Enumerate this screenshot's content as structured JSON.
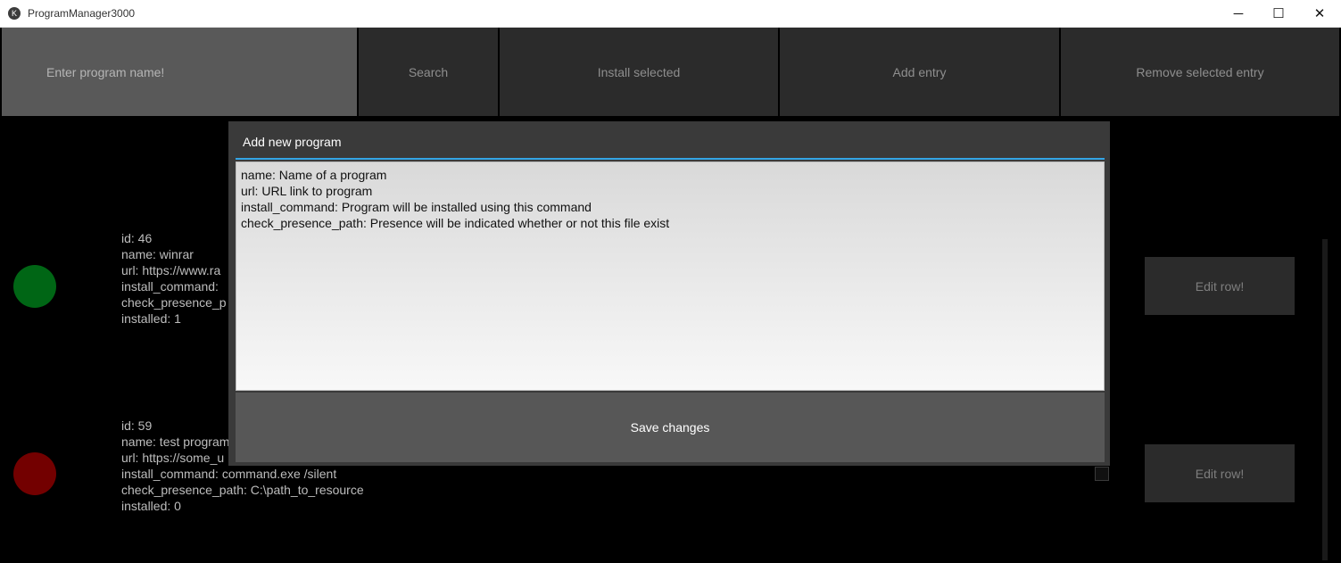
{
  "window": {
    "title": "ProgramManager3000",
    "app_icon": "kivy-icon",
    "minimize": "─",
    "maximize": "☐",
    "close": "✕"
  },
  "toolbar": {
    "search_placeholder": "Enter program name!",
    "search_label": "Search",
    "install_label": "Install selected",
    "add_label": "Add entry",
    "remove_label": "Remove selected entry"
  },
  "rows": [
    {
      "status_color": "#006615",
      "lines": "id: 46\nname: winrar\nurl: https://www.ra\ninstall_command: \ncheck_presence_p\ninstalled: 1",
      "edit_label": "Edit row!"
    },
    {
      "status_color": "#730000",
      "lines": "id: 59\nname: test program\nurl: https://some_u\ninstall_command: command.exe /silent\ncheck_presence_path: C:\\path_to_resource\ninstalled: 0",
      "edit_label": "Edit row!"
    }
  ],
  "dialog": {
    "title": "Add new program",
    "text": "name: Name of a program\nurl: URL link to program\ninstall_command: Program will be installed using this command\ncheck_presence_path: Presence will be indicated whether or not this file exist",
    "save_label": "Save changes"
  }
}
